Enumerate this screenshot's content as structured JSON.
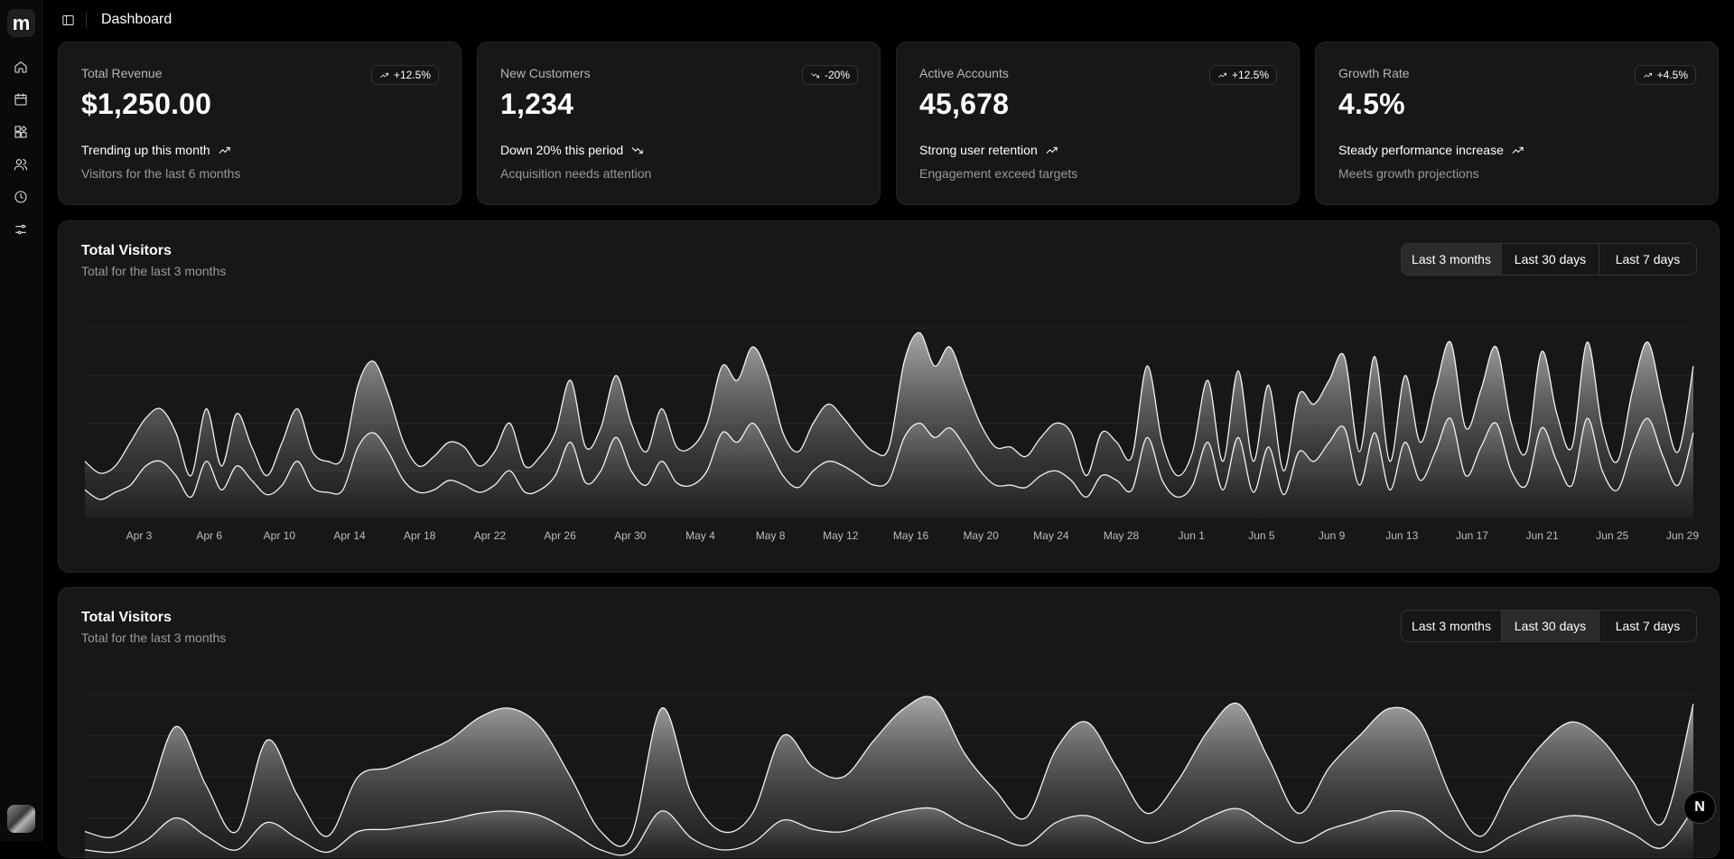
{
  "app": {
    "logo_letter": "m",
    "page_title": "Dashboard"
  },
  "sidebar": {
    "items": [
      {
        "icon": "home-icon"
      },
      {
        "icon": "calendar-icon"
      },
      {
        "icon": "widgets-icon"
      },
      {
        "icon": "users-icon"
      },
      {
        "icon": "clock-icon"
      },
      {
        "icon": "sliders-icon"
      }
    ]
  },
  "stats": [
    {
      "label": "Total Revenue",
      "value": "$1,250.00",
      "badge": "+12.5%",
      "direction": "up",
      "trend": "Trending up this month",
      "sub": "Visitors for the last 6 months"
    },
    {
      "label": "New Customers",
      "value": "1,234",
      "badge": "-20%",
      "direction": "down",
      "trend": "Down 20% this period",
      "sub": "Acquisition needs attention"
    },
    {
      "label": "Active Accounts",
      "value": "45,678",
      "badge": "+12.5%",
      "direction": "up",
      "trend": "Strong user retention",
      "sub": "Engagement exceed targets"
    },
    {
      "label": "Growth Rate",
      "value": "4.5%",
      "badge": "+4.5%",
      "direction": "up",
      "trend": "Steady performance increase",
      "sub": "Meets growth projections"
    }
  ],
  "charts": [
    {
      "title": "Total Visitors",
      "subtitle": "Total for the last 3 months",
      "ranges": [
        "Last 3 months",
        "Last 30 days",
        "Last 7 days"
      ],
      "active_range": 0
    },
    {
      "title": "Total Visitors",
      "subtitle": "Total for the last 3 months",
      "ranges": [
        "Last 3 months",
        "Last 30 days",
        "Last 7 days"
      ],
      "active_range": 1
    }
  ],
  "floating": {
    "label": "N"
  },
  "chart_data": [
    {
      "type": "area",
      "title": "Total Visitors",
      "subtitle": "Total for the last 3 months",
      "x_tick_labels": [
        "Apr 3",
        "Apr 6",
        "Apr 10",
        "Apr 14",
        "Apr 18",
        "Apr 22",
        "Apr 26",
        "Apr 30",
        "May 4",
        "May 8",
        "May 12",
        "May 16",
        "May 20",
        "May 24",
        "May 28",
        "Jun 1",
        "Jun 5",
        "Jun 9",
        "Jun 13",
        "Jun 17",
        "Jun 21",
        "Jun 25",
        "Jun 29"
      ],
      "series": [
        {
          "values": [
            120,
            95,
            110,
            160,
            210,
            230,
            180,
            90,
            230,
            110,
            220,
            150,
            90,
            160,
            230,
            140,
            120,
            130,
            280,
            330,
            260,
            160,
            110,
            130,
            160,
            150,
            110,
            140,
            200,
            110,
            130,
            180,
            290,
            150,
            190,
            300,
            200,
            140,
            230,
            150,
            150,
            200,
            320,
            290,
            360,
            300,
            180,
            140,
            200,
            240,
            210,
            170,
            140,
            150,
            330,
            390,
            320,
            360,
            280,
            200,
            150,
            150,
            130,
            170,
            200,
            180,
            90,
            180,
            160,
            130,
            320,
            160,
            90,
            140,
            290,
            120,
            310,
            120,
            280,
            100,
            260,
            240,
            290,
            340,
            140,
            340,
            120,
            300,
            160,
            270,
            370,
            190,
            270,
            360,
            200,
            140,
            350,
            220,
            150,
            370,
            190,
            120,
            270,
            370,
            240,
            140,
            320
          ]
        },
        {
          "values": [
            60,
            40,
            55,
            70,
            110,
            120,
            90,
            45,
            120,
            60,
            110,
            80,
            50,
            70,
            120,
            65,
            55,
            60,
            150,
            180,
            140,
            80,
            55,
            60,
            80,
            70,
            55,
            70,
            100,
            55,
            60,
            90,
            160,
            75,
            100,
            170,
            100,
            70,
            120,
            75,
            70,
            100,
            180,
            160,
            200,
            150,
            90,
            65,
            100,
            120,
            110,
            90,
            70,
            80,
            170,
            200,
            170,
            190,
            150,
            100,
            70,
            70,
            65,
            90,
            100,
            80,
            45,
            90,
            80,
            60,
            170,
            80,
            45,
            70,
            160,
            60,
            170,
            55,
            150,
            50,
            140,
            120,
            160,
            190,
            70,
            180,
            60,
            160,
            80,
            140,
            210,
            90,
            150,
            200,
            100,
            70,
            190,
            120,
            70,
            210,
            100,
            60,
            150,
            210,
            130,
            70,
            180
          ]
        }
      ]
    },
    {
      "type": "area",
      "title": "Total Visitors",
      "subtitle": "Total for the last 3 months",
      "series": [
        {
          "values": [
            60,
            50,
            120,
            290,
            160,
            60,
            260,
            140,
            50,
            180,
            200,
            230,
            260,
            310,
            330,
            290,
            180,
            60,
            50,
            330,
            140,
            60,
            100,
            270,
            200,
            180,
            260,
            330,
            350,
            230,
            150,
            90,
            240,
            300,
            200,
            100,
            170,
            280,
            340,
            220,
            100,
            200,
            270,
            330,
            300,
            140,
            50,
            160,
            250,
            300,
            260,
            170,
            80,
            340
          ]
        },
        {
          "values": [
            20,
            15,
            40,
            90,
            50,
            20,
            80,
            45,
            15,
            60,
            65,
            75,
            85,
            100,
            105,
            95,
            60,
            20,
            15,
            105,
            45,
            20,
            35,
            85,
            65,
            60,
            85,
            105,
            110,
            75,
            50,
            30,
            80,
            95,
            65,
            35,
            55,
            90,
            110,
            70,
            35,
            65,
            85,
            105,
            95,
            45,
            15,
            50,
            80,
            95,
            85,
            55,
            25,
            110
          ]
        }
      ]
    }
  ]
}
